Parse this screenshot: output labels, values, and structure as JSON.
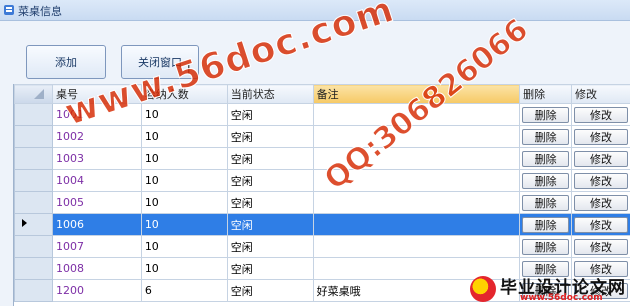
{
  "window": {
    "title": "菜桌信息"
  },
  "toolbar": {
    "add_label": "添加",
    "close_label": "关闭窗口"
  },
  "grid": {
    "columns": [
      "桌号",
      "容纳人数",
      "当前状态",
      "备注",
      "删除",
      "修改"
    ],
    "rows": [
      {
        "id": "1001",
        "capacity": "10",
        "status": "空闲",
        "note": "",
        "delete": "删除",
        "edit": "修改"
      },
      {
        "id": "1002",
        "capacity": "10",
        "status": "空闲",
        "note": "",
        "delete": "删除",
        "edit": "修改"
      },
      {
        "id": "1003",
        "capacity": "10",
        "status": "空闲",
        "note": "",
        "delete": "删除",
        "edit": "修改"
      },
      {
        "id": "1004",
        "capacity": "10",
        "status": "空闲",
        "note": "",
        "delete": "删除",
        "edit": "修改"
      },
      {
        "id": "1005",
        "capacity": "10",
        "status": "空闲",
        "note": "",
        "delete": "删除",
        "edit": "修改"
      },
      {
        "id": "1006",
        "capacity": "10",
        "status": "空闲",
        "note": "",
        "delete": "删除",
        "edit": "修改"
      },
      {
        "id": "1007",
        "capacity": "10",
        "status": "空闲",
        "note": "",
        "delete": "删除",
        "edit": "修改"
      },
      {
        "id": "1008",
        "capacity": "10",
        "status": "空闲",
        "note": "",
        "delete": "删除",
        "edit": "修改"
      },
      {
        "id": "1200",
        "capacity": "6",
        "status": "空闲",
        "note": "好菜桌哦",
        "delete": "删除",
        "edit": "修改"
      }
    ],
    "selected_row": 5,
    "selected_column": 3
  },
  "watermark": {
    "site": "www.56doc.com",
    "qq": "QQ:306826066"
  },
  "logo": {
    "brand": "毕业设计论文网",
    "url": "www.56doc.com"
  },
  "colors": {
    "accent": "#2f7ee6",
    "id_text": "#7d2fa6",
    "watermark": "#d62800"
  }
}
